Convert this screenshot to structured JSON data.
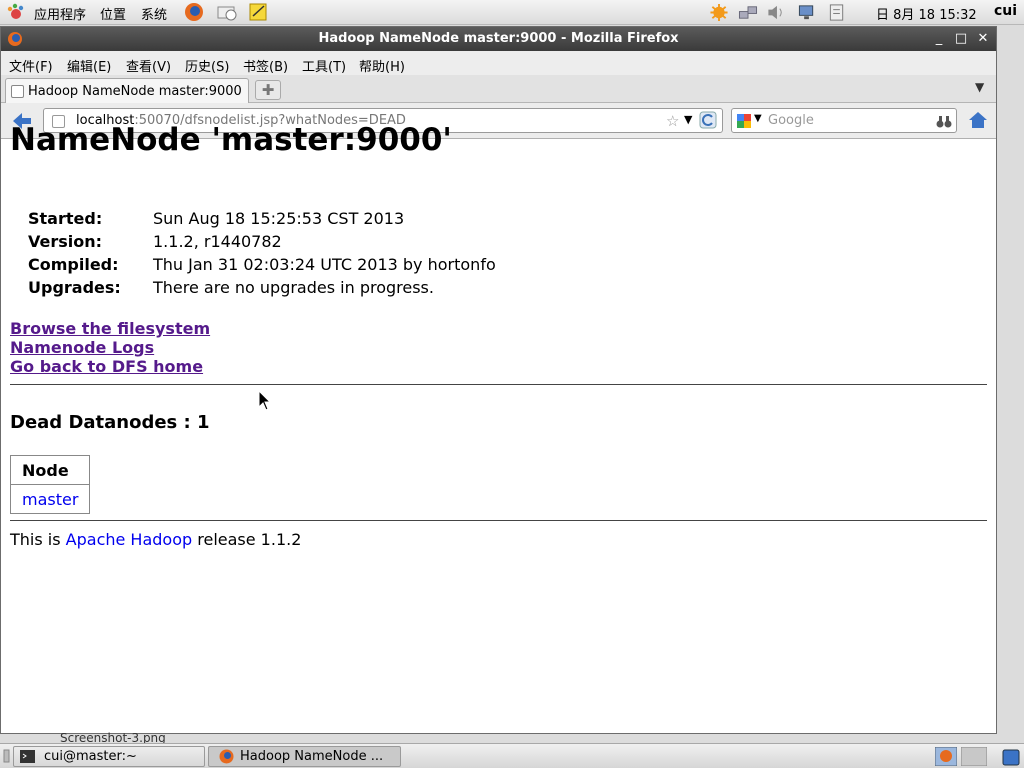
{
  "topbar": {
    "menus": [
      "应用程序",
      "位置",
      "系统"
    ],
    "clock": "日 8月 18 15:32",
    "user": "cui"
  },
  "window": {
    "title": "Hadoop NameNode master:9000 - Mozilla Firefox",
    "menubar": [
      "文件(F)",
      "编辑(E)",
      "查看(V)",
      "历史(S)",
      "书签(B)",
      "工具(T)",
      "帮助(H)"
    ],
    "tab_label": "Hadoop NameNode master:9000",
    "url_host": "localhost",
    "url_rest": ":50070/dfsnodelist.jsp?whatNodes=DEAD",
    "search_placeholder": "Google"
  },
  "page": {
    "title": "NameNode 'master:9000'",
    "info": [
      {
        "key": "Started:",
        "value": "Sun Aug 18 15:25:53 CST 2013"
      },
      {
        "key": "Version:",
        "value": "1.1.2, r1440782"
      },
      {
        "key": "Compiled:",
        "value": "Thu Jan 31 02:03:24 UTC 2013 by hortonfo"
      },
      {
        "key": "Upgrades:",
        "value": "There are no upgrades in progress."
      }
    ],
    "links": [
      "Browse the filesystem",
      "Namenode Logs",
      "Go back to DFS home"
    ],
    "dead_heading": "Dead Datanodes : 1",
    "table_header": "Node",
    "table_rows": [
      "master"
    ],
    "footer_pre": "This is ",
    "footer_link": "Apache Hadoop",
    "footer_post": " release 1.1.2"
  },
  "desktop_label": "Screenshot-3.png",
  "taskbar": {
    "tasks": [
      "cui@master:~",
      "Hadoop NameNode ..."
    ]
  }
}
